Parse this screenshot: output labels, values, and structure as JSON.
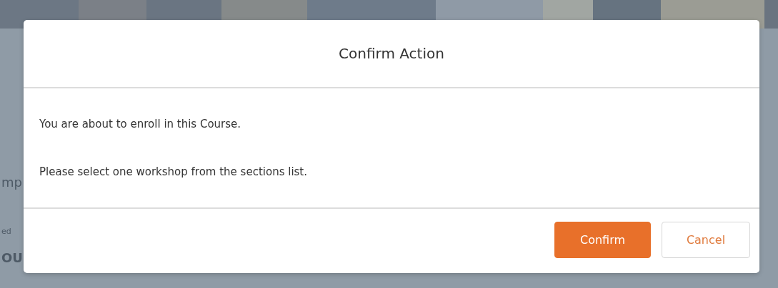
{
  "background": {
    "fragments": [
      {
        "kind": "heading",
        "text": "mp"
      },
      {
        "kind": "caption",
        "text": "ed"
      },
      {
        "kind": "bold",
        "text": "OU"
      }
    ]
  },
  "dialog": {
    "title": "Confirm Action",
    "messages": [
      "You are about to enroll in this Course.",
      "Please select one workshop from the sections list."
    ],
    "buttons": [
      {
        "label": "Confirm",
        "kind": "primary"
      },
      {
        "label": "Cancel",
        "kind": "secondary"
      }
    ]
  }
}
